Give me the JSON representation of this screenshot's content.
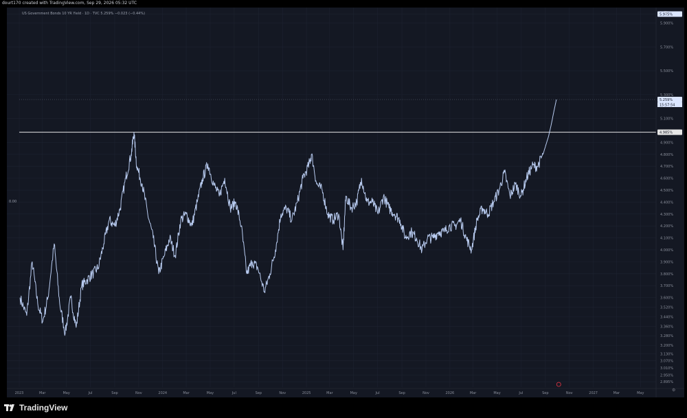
{
  "header": {
    "created_text": "dourt170 created with TradingView.com, Sep 29, 2026 05:32 UTC"
  },
  "legend": {
    "text": "US Government Bonds 10 YR Yield · 1D · TVC  5.259%  −0.023 (−0.44%)"
  },
  "left_axis_label": "0.00",
  "percent_symbol": "%",
  "footer": {
    "brand": "TradingView"
  },
  "chart_data": {
    "type": "line",
    "title": "US Government Bonds 10 YR Yield · 1D · TVC",
    "ylim": [
      2.85,
      5.995
    ],
    "y_ticks": [
      "5.975%",
      "5.900%",
      "5.700%",
      "5.500%",
      "5.300%",
      "5.100%",
      "4.900%",
      "4.800%",
      "4.700%",
      "4.600%",
      "4.500%",
      "4.400%",
      "4.300%",
      "4.200%",
      "4.100%",
      "4.000%",
      "3.900%",
      "3.800%",
      "3.700%",
      "3.600%",
      "3.520%",
      "3.440%",
      "3.360%",
      "3.280%",
      "3.200%",
      "3.130%",
      "3.070%",
      "3.010%",
      "2.950%",
      "2.895%"
    ],
    "x_ticks": [
      "2023",
      "Mar",
      "May",
      "Jul",
      "Sep",
      "Nov",
      "2024",
      "Mar",
      "May",
      "Jul",
      "Sep",
      "Nov",
      "2025",
      "Mar",
      "May",
      "Jul",
      "Sep",
      "Nov",
      "2026",
      "Mar",
      "May",
      "Jul",
      "Sep",
      "Nov",
      "2027",
      "Mar",
      "May"
    ],
    "x_start": "2023-01",
    "x_end": "2027-06",
    "horizontal_level": {
      "value": 4.985,
      "label": "4.985%"
    },
    "last_price": {
      "value": 5.259,
      "label": "5.259%",
      "countdown": "15:57:54",
      "dotted_line": true
    },
    "top_price_label": "5.975%",
    "series": [
      {
        "values": [
          {
            "x": "2023-01-03",
            "y": 3.6
          },
          {
            "x": "2023-01-20",
            "y": 3.45
          },
          {
            "x": "2023-02-03",
            "y": 3.9
          },
          {
            "x": "2023-02-17",
            "y": 3.55
          },
          {
            "x": "2023-03-02",
            "y": 3.4
          },
          {
            "x": "2023-03-15",
            "y": 3.6
          },
          {
            "x": "2023-03-31",
            "y": 4.05
          },
          {
            "x": "2023-04-14",
            "y": 3.55
          },
          {
            "x": "2023-04-28",
            "y": 3.3
          },
          {
            "x": "2023-05-12",
            "y": 3.6
          },
          {
            "x": "2023-05-26",
            "y": 3.35
          },
          {
            "x": "2023-06-09",
            "y": 3.7
          },
          {
            "x": "2023-06-23",
            "y": 3.75
          },
          {
            "x": "2023-07-07",
            "y": 3.8
          },
          {
            "x": "2023-07-21",
            "y": 3.85
          },
          {
            "x": "2023-08-04",
            "y": 4.05
          },
          {
            "x": "2023-08-18",
            "y": 4.25
          },
          {
            "x": "2023-09-01",
            "y": 4.2
          },
          {
            "x": "2023-09-15",
            "y": 4.35
          },
          {
            "x": "2023-09-29",
            "y": 4.6
          },
          {
            "x": "2023-10-13",
            "y": 4.8
          },
          {
            "x": "2023-10-20",
            "y": 4.985
          },
          {
            "x": "2023-10-27",
            "y": 4.7
          },
          {
            "x": "2023-11-10",
            "y": 4.55
          },
          {
            "x": "2023-11-24",
            "y": 4.3
          },
          {
            "x": "2023-12-08",
            "y": 4.1
          },
          {
            "x": "2023-12-22",
            "y": 3.8
          },
          {
            "x": "2024-01-05",
            "y": 3.95
          },
          {
            "x": "2024-01-19",
            "y": 4.1
          },
          {
            "x": "2024-02-02",
            "y": 3.95
          },
          {
            "x": "2024-02-16",
            "y": 4.25
          },
          {
            "x": "2024-03-01",
            "y": 4.3
          },
          {
            "x": "2024-03-15",
            "y": 4.2
          },
          {
            "x": "2024-03-29",
            "y": 4.4
          },
          {
            "x": "2024-04-12",
            "y": 4.6
          },
          {
            "x": "2024-04-25",
            "y": 4.72
          },
          {
            "x": "2024-05-10",
            "y": 4.55
          },
          {
            "x": "2024-05-24",
            "y": 4.45
          },
          {
            "x": "2024-06-07",
            "y": 4.6
          },
          {
            "x": "2024-06-21",
            "y": 4.35
          },
          {
            "x": "2024-07-05",
            "y": 4.4
          },
          {
            "x": "2024-07-19",
            "y": 4.2
          },
          {
            "x": "2024-08-02",
            "y": 3.8
          },
          {
            "x": "2024-08-16",
            "y": 3.9
          },
          {
            "x": "2024-08-30",
            "y": 3.85
          },
          {
            "x": "2024-09-16",
            "y": 3.65
          },
          {
            "x": "2024-09-30",
            "y": 3.8
          },
          {
            "x": "2024-10-14",
            "y": 4.0
          },
          {
            "x": "2024-10-28",
            "y": 4.3
          },
          {
            "x": "2024-11-11",
            "y": 4.35
          },
          {
            "x": "2024-11-25",
            "y": 4.25
          },
          {
            "x": "2024-12-09",
            "y": 4.4
          },
          {
            "x": "2024-12-23",
            "y": 4.6
          },
          {
            "x": "2025-01-06",
            "y": 4.7
          },
          {
            "x": "2025-01-14",
            "y": 4.8
          },
          {
            "x": "2025-01-27",
            "y": 4.55
          },
          {
            "x": "2025-02-10",
            "y": 4.5
          },
          {
            "x": "2025-02-24",
            "y": 4.3
          },
          {
            "x": "2025-03-10",
            "y": 4.25
          },
          {
            "x": "2025-03-24",
            "y": 4.3
          },
          {
            "x": "2025-04-04",
            "y": 4.0
          },
          {
            "x": "2025-04-11",
            "y": 4.45
          },
          {
            "x": "2025-04-25",
            "y": 4.35
          },
          {
            "x": "2025-05-09",
            "y": 4.4
          },
          {
            "x": "2025-05-21",
            "y": 4.6
          },
          {
            "x": "2025-06-04",
            "y": 4.4
          },
          {
            "x": "2025-06-18",
            "y": 4.4
          },
          {
            "x": "2025-07-02",
            "y": 4.3
          },
          {
            "x": "2025-07-16",
            "y": 4.45
          },
          {
            "x": "2025-07-30",
            "y": 4.35
          },
          {
            "x": "2025-08-13",
            "y": 4.3
          },
          {
            "x": "2025-08-27",
            "y": 4.25
          },
          {
            "x": "2025-09-10",
            "y": 4.1
          },
          {
            "x": "2025-09-24",
            "y": 4.15
          },
          {
            "x": "2025-10-08",
            "y": 4.1
          },
          {
            "x": "2025-10-22",
            "y": 4.0
          },
          {
            "x": "2025-11-05",
            "y": 4.1
          },
          {
            "x": "2025-11-19",
            "y": 4.1
          },
          {
            "x": "2025-12-03",
            "y": 4.15
          },
          {
            "x": "2025-12-17",
            "y": 4.15
          },
          {
            "x": "2025-12-31",
            "y": 4.2
          },
          {
            "x": "2026-01-14",
            "y": 4.2
          },
          {
            "x": "2026-01-28",
            "y": 4.25
          },
          {
            "x": "2026-02-11",
            "y": 4.1
          },
          {
            "x": "2026-02-25",
            "y": 4.0
          },
          {
            "x": "2026-03-11",
            "y": 4.25
          },
          {
            "x": "2026-03-25",
            "y": 4.35
          },
          {
            "x": "2026-04-08",
            "y": 4.3
          },
          {
            "x": "2026-04-22",
            "y": 4.4
          },
          {
            "x": "2026-05-06",
            "y": 4.5
          },
          {
            "x": "2026-05-20",
            "y": 4.65
          },
          {
            "x": "2026-06-03",
            "y": 4.45
          },
          {
            "x": "2026-06-17",
            "y": 4.55
          },
          {
            "x": "2026-07-01",
            "y": 4.45
          },
          {
            "x": "2026-07-15",
            "y": 4.6
          },
          {
            "x": "2026-07-29",
            "y": 4.7
          },
          {
            "x": "2026-08-12",
            "y": 4.7
          },
          {
            "x": "2026-08-26",
            "y": 4.8
          },
          {
            "x": "2026-09-09",
            "y": 4.95
          },
          {
            "x": "2026-09-16",
            "y": 5.05
          },
          {
            "x": "2026-09-22",
            "y": 5.15
          },
          {
            "x": "2026-09-29",
            "y": 5.259
          }
        ]
      }
    ],
    "grid": true,
    "colors": {
      "background": "#141823",
      "line": "#b8cbf0",
      "grid": "#1d2230",
      "level_line": "#e6e6e6",
      "axis_text": "#8a8f9b",
      "price_label_bg": "#dbe6ff"
    }
  }
}
